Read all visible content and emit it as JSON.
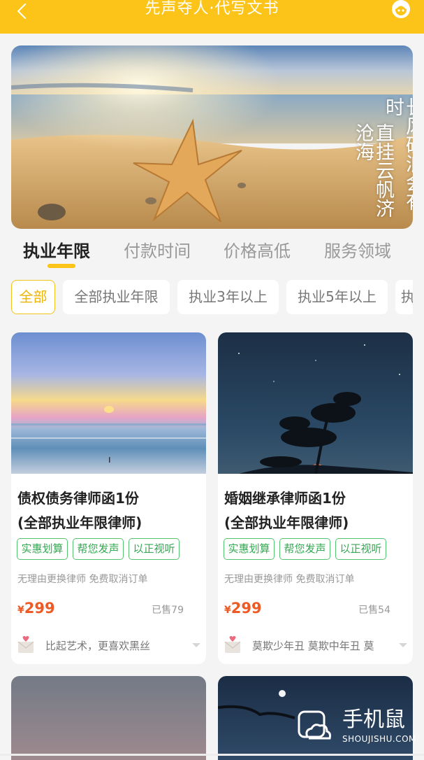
{
  "header": {
    "title": "先声夺人·代写文书",
    "back_icon": "back-arrow-icon",
    "service_icon": "customer-service-icon"
  },
  "banner": {
    "poem_line_1": "长风破浪会有时",
    "poem_line_2": "直挂云帆济沧海"
  },
  "tabs": [
    "执业年限",
    "付款时间",
    "价格高低",
    "服务领域"
  ],
  "active_tab": 0,
  "filters": [
    "全部",
    "全部执业年限",
    "执业3年以上",
    "执业5年以上",
    "执"
  ],
  "products": [
    {
      "title_line1": "债权债务律师函1份",
      "title_line2": "(全部执业年限律师)",
      "tags": [
        "实惠划算",
        "帮您发声",
        "以正视听"
      ],
      "policy": "无理由更换律师 免费取消订单",
      "currency": "¥",
      "price": "299",
      "sold": "已售79",
      "seller_text": "比起艺术，更喜欢黑丝"
    },
    {
      "title_line1": "婚姻继承律师函1份",
      "title_line2": "(全部执业年限律师)",
      "tags": [
        "实惠划算",
        "帮您发声",
        "以正视听"
      ],
      "policy": "无理由更换律师 免费取消订单",
      "currency": "¥",
      "price": "299",
      "sold": "已售54",
      "seller_text": "莫欺少年丑 莫欺中年丑 莫"
    }
  ],
  "watermark": {
    "text": "手机鼠",
    "sub": "SHOUJISHU.COM"
  },
  "colors": {
    "accent": "#fcc419",
    "price": "#ee5a24",
    "tag": "#35a852"
  }
}
